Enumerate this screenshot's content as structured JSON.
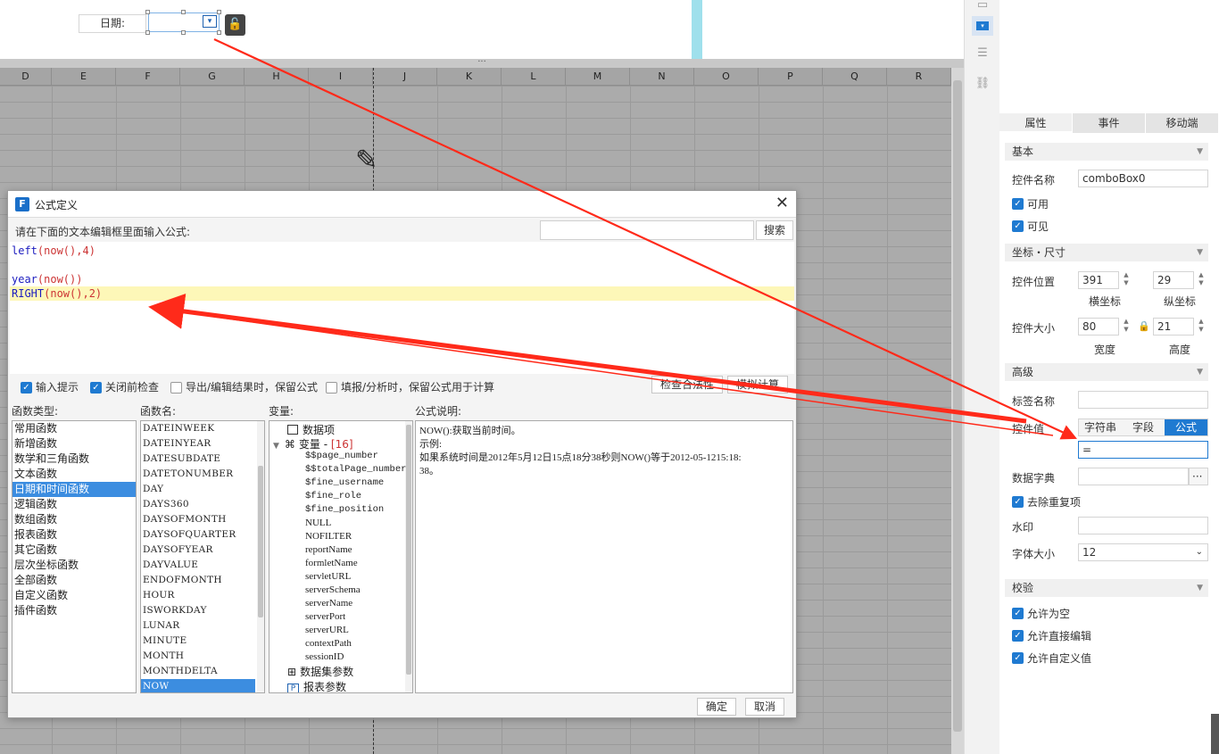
{
  "canvas": {
    "date_label": "日期:",
    "dropdown_glyph": "▾",
    "lock_glyph": "🔓"
  },
  "sheet": {
    "columns": [
      "D",
      "E",
      "F",
      "G",
      "H",
      "I",
      "J",
      "K",
      "L",
      "M",
      "N",
      "O",
      "P",
      "Q",
      "R"
    ],
    "splitter_glyph": "···",
    "pencil_glyph": "✎"
  },
  "side_strip": {
    "icons": [
      "panel-icon",
      "dropdown-widget-icon",
      "layers-icon",
      "link-icon"
    ]
  },
  "props": {
    "tabs": [
      "属性",
      "事件",
      "移动端"
    ],
    "active_tab": "属性",
    "basic": {
      "section": "基本",
      "name_label": "控件名称",
      "name_value": "comboBox0",
      "enabled_label": "可用",
      "visible_label": "可见"
    },
    "geometry": {
      "section": "坐标・尺寸",
      "pos_label": "控件位置",
      "pos_x": "391",
      "pos_y": "29",
      "x_caption": "横坐标",
      "y_caption": "纵坐标",
      "size_label": "控件大小",
      "width": "80",
      "height": "21",
      "w_caption": "宽度",
      "h_caption": "高度"
    },
    "advanced": {
      "section": "高级",
      "tag_label": "标签名称",
      "value_label": "控件值",
      "seg_string": "字符串",
      "seg_field": "字段",
      "seg_formula": "公式",
      "formula_value": "=",
      "dict_label": "数据字典",
      "dict_btn": "···",
      "dedupe_label": "去除重复项",
      "watermark_label": "水印",
      "fontsize_label": "字体大小",
      "fontsize_value": "12"
    },
    "validation": {
      "section": "校验",
      "allow_empty": "允许为空",
      "allow_edit": "允许直接编辑",
      "allow_custom": "允许自定义值"
    }
  },
  "dialog": {
    "title": "公式定义",
    "close": "✕",
    "logo": "F",
    "prompt": "请在下面的文本编辑框里面输入公式:",
    "search_btn": "搜索",
    "code": {
      "l1_fn": "left",
      "l1_rest": "(now(),4)",
      "l2_fn": "year",
      "l2_rest": "(now())",
      "l3_fn": "RIGHT",
      "l3_rest": "(now(),2)"
    },
    "options": {
      "input_hint": "输入提示",
      "check_before_close": "关闭前检查",
      "export_keep": "导出/编辑结果时，保留公式",
      "fill_keep": "填报/分析时，保留公式用于计算"
    },
    "check_btn": "检查合法性",
    "simulate_btn": "模拟计算",
    "headers": {
      "type": "函数类型:",
      "name": "函数名:",
      "var": "变量:",
      "desc": "公式说明:"
    },
    "func_types": [
      "常用函数",
      "新增函数",
      "数学和三角函数",
      "文本函数",
      "日期和时间函数",
      "逻辑函数",
      "数组函数",
      "报表函数",
      "其它函数",
      "层次坐标函数",
      "全部函数",
      "自定义函数",
      "插件函数"
    ],
    "func_type_selected": "日期和时间函数",
    "func_names": [
      "DATEINWEEK",
      "DATEINYEAR",
      "DATESUBDATE",
      "DATETONUMBER",
      "DAY",
      "DAYS360",
      "DAYSOFMONTH",
      "DAYSOFQUARTER",
      "DAYSOFYEAR",
      "DAYVALUE",
      "ENDOFMONTH",
      "HOUR",
      "ISWORKDAY",
      "LUNAR",
      "MINUTE",
      "MONTH",
      "MONTHDELTA",
      "NOW"
    ],
    "func_name_selected": "NOW",
    "variables": {
      "data_item": "数据项",
      "var_group": "变量 - ",
      "var_count": "[16]",
      "items": [
        "$$page_number",
        "$$totalPage_number",
        "$fine_username",
        "$fine_role",
        "$fine_position",
        "NULL",
        "NOFILTER",
        "reportName",
        "formletName",
        "servletURL",
        "serverSchema",
        "serverName",
        "serverPort",
        "serverURL",
        "contextPath",
        "sessionID"
      ],
      "dataset_params": "数据集参数",
      "report_params": "报表参数"
    },
    "description": {
      "line1": "NOW():获取当前时间。",
      "line2": "示例:",
      "line3": "如果系统时间是2012年5月12日15点18分38秒则NOW()等于2012-05-1215:18:",
      "line4": "38。"
    },
    "ok_btn": "确定",
    "cancel_btn": "取消"
  },
  "colors": {
    "accent": "#1f7ad1",
    "arrow": "#ff2a1a",
    "highlight_line": "#fdf7b8"
  }
}
